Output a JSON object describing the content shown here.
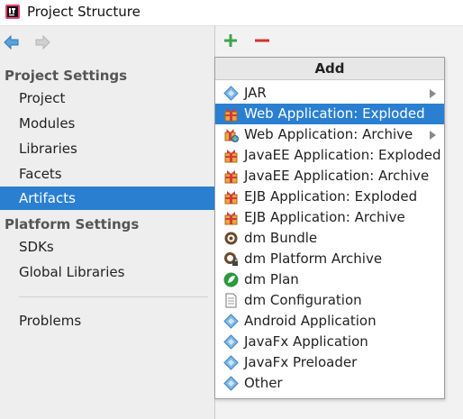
{
  "window": {
    "title": "Project Structure"
  },
  "toolbar": {
    "back_icon": "back-arrow-icon",
    "forward_icon": "forward-arrow-icon"
  },
  "sidebar": {
    "sections": [
      {
        "header": "Project Settings",
        "items": [
          "Project",
          "Modules",
          "Libraries",
          "Facets",
          "Artifacts"
        ]
      },
      {
        "header": "Platform Settings",
        "items": [
          "SDKs",
          "Global Libraries"
        ]
      }
    ],
    "extra_items": [
      "Problems"
    ],
    "selected": "Artifacts"
  },
  "content_toolbar": {
    "add_icon": "plus-icon",
    "remove_icon": "minus-icon"
  },
  "popup": {
    "title": "Add",
    "highlighted": "Web Application: Exploded",
    "items": [
      {
        "label": "JAR",
        "icon": "jar-icon",
        "submenu": true
      },
      {
        "label": "Web Application: Exploded",
        "icon": "package-icon",
        "submenu": false
      },
      {
        "label": "Web Application: Archive",
        "icon": "package-globe-icon",
        "submenu": true
      },
      {
        "label": "JavaEE Application: Exploded",
        "icon": "package-icon",
        "submenu": false
      },
      {
        "label": "JavaEE Application: Archive",
        "icon": "package-icon",
        "submenu": false
      },
      {
        "label": "EJB Application: Exploded",
        "icon": "package-icon",
        "submenu": false
      },
      {
        "label": "EJB Application: Archive",
        "icon": "package-icon",
        "submenu": false
      },
      {
        "label": "dm Bundle",
        "icon": "bundle-icon",
        "submenu": false
      },
      {
        "label": "dm Platform Archive",
        "icon": "bundle-lock-icon",
        "submenu": false
      },
      {
        "label": "dm Plan",
        "icon": "plan-icon",
        "submenu": false
      },
      {
        "label": "dm Configuration",
        "icon": "document-icon",
        "submenu": false
      },
      {
        "label": "Android Application",
        "icon": "diamond-icon",
        "submenu": false
      },
      {
        "label": "JavaFx Application",
        "icon": "diamond-icon",
        "submenu": false
      },
      {
        "label": "JavaFx Preloader",
        "icon": "diamond-icon",
        "submenu": false
      },
      {
        "label": "Other",
        "icon": "diamond-icon",
        "submenu": false
      }
    ]
  },
  "colors": {
    "selection": "#2a7fd1",
    "add": "#3fa34d",
    "remove": "#d9302b"
  }
}
